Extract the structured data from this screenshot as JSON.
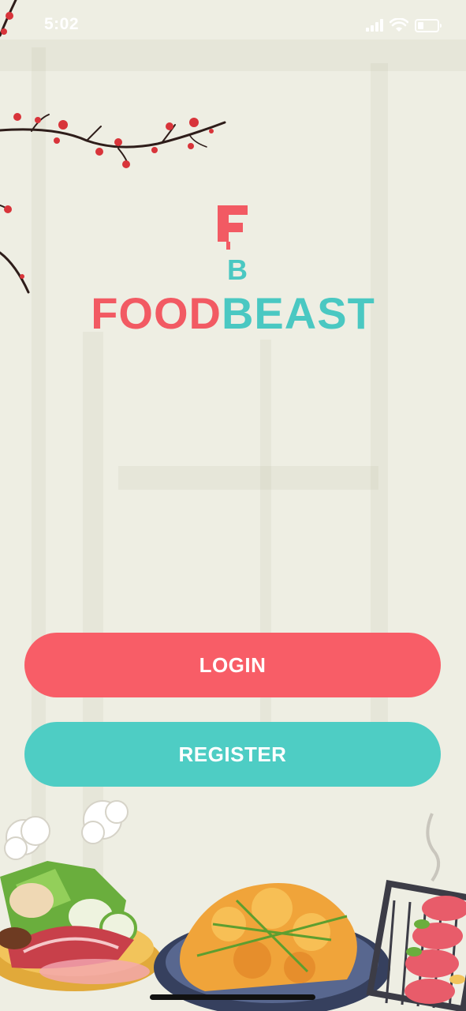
{
  "status_bar": {
    "time": "5:02",
    "icons": [
      "cellular-signal-icon",
      "wifi-icon",
      "battery-icon"
    ],
    "battery_level": 0.3
  },
  "logo": {
    "icon_name": "foodbeast-fb-logo",
    "wordmark_part1": "FOOD",
    "wordmark_part2": "BEAST"
  },
  "actions": {
    "login_label": "LOGIN",
    "register_label": "REGISTER"
  },
  "colors": {
    "background": "#eeeee3",
    "brand_red": "#f85d67",
    "brand_teal": "#4ecdc4"
  }
}
